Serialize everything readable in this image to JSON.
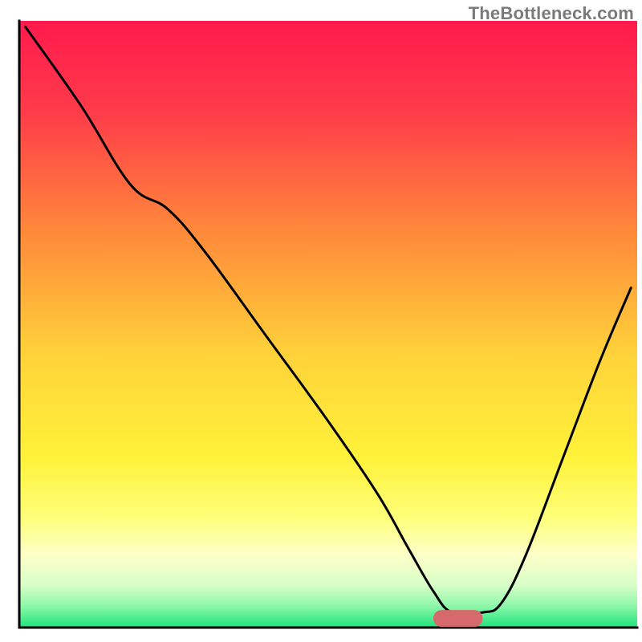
{
  "watermark": "TheBottleneck.com",
  "chart_data": {
    "type": "line",
    "title": "",
    "xlabel": "",
    "ylabel": "",
    "xlim": [
      0,
      100
    ],
    "ylim": [
      0,
      100
    ],
    "grid": false,
    "legend": false,
    "background_gradient": {
      "stops": [
        {
          "offset": 0.0,
          "color": "#ff1a4d"
        },
        {
          "offset": 0.15,
          "color": "#ff3b4a"
        },
        {
          "offset": 0.35,
          "color": "#ff8a3a"
        },
        {
          "offset": 0.55,
          "color": "#ffd23a"
        },
        {
          "offset": 0.72,
          "color": "#fff23a"
        },
        {
          "offset": 0.82,
          "color": "#fdff7a"
        },
        {
          "offset": 0.88,
          "color": "#fdffc8"
        },
        {
          "offset": 0.93,
          "color": "#d8ffc8"
        },
        {
          "offset": 0.965,
          "color": "#8cf7a8"
        },
        {
          "offset": 1.0,
          "color": "#1de57c"
        }
      ]
    },
    "series": [
      {
        "name": "bottleneck-curve",
        "color": "#000000",
        "x": [
          1.0,
          10.0,
          18.0,
          24.0,
          30.0,
          40.0,
          50.0,
          58.0,
          63.0,
          67.0,
          70.0,
          75.0,
          78.0,
          82.0,
          88.0,
          94.0,
          99.0
        ],
        "values": [
          99.0,
          86.0,
          73.0,
          69.0,
          62.0,
          48.0,
          34.0,
          22.0,
          13.0,
          6.0,
          2.5,
          2.5,
          4.0,
          12.0,
          28.0,
          44.0,
          56.0
        ]
      }
    ],
    "marker": {
      "name": "optimal-range",
      "color": "#d6696c",
      "x_start": 67.0,
      "x_end": 75.0,
      "y": 1.5,
      "thickness": 2.8
    }
  }
}
